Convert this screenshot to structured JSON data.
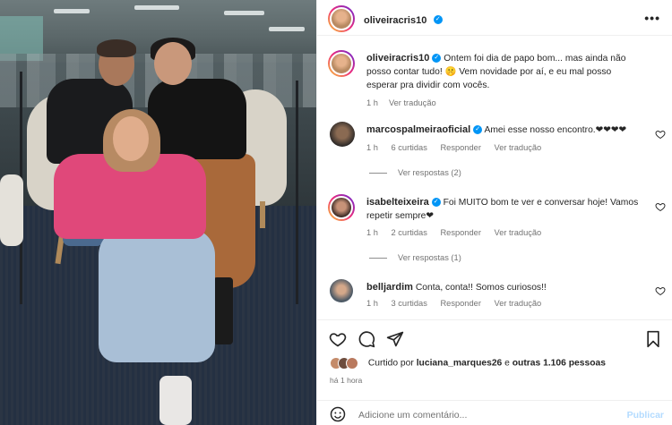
{
  "post": {
    "author": "oliveiracris10",
    "caption": "Ontem foi dia de papo bom... mas ainda não posso contar tudo! 🤫 Vem novidade por aí, e eu mal posso esperar pra dividir com vocês.",
    "caption_time": "1 h",
    "caption_translate": "Ver tradução"
  },
  "comments": [
    {
      "user": "marcospalmeiraoficial",
      "verified": true,
      "text": "Amei esse nosso encontro.❤❤❤❤",
      "time": "1 h",
      "likes": "6 curtidas",
      "reply": "Responder",
      "translate": "Ver tradução",
      "replies": "Ver respostas (2)"
    },
    {
      "user": "isabelteixeira",
      "verified": true,
      "text": "Foi MUITO bom te ver e conversar hoje! Vamos repetir sempre❤",
      "time": "1 h",
      "likes": "2 curtidas",
      "reply": "Responder",
      "translate": "Ver tradução",
      "replies": "Ver respostas (1)"
    },
    {
      "user": "belljardim",
      "verified": false,
      "text": "Conta, conta!! Somos curiosos!!",
      "time": "1 h",
      "likes": "3 curtidas",
      "reply": "Responder",
      "translate": "Ver tradução"
    }
  ],
  "likes_summary": {
    "prefix": "Curtido por",
    "user": "luciana_marques26",
    "middle": "e",
    "others": "outras 1.106 pessoas"
  },
  "posted_ago": "há 1 hora",
  "add_comment": {
    "placeholder": "Adicione um comentário...",
    "publish": "Publicar"
  },
  "icons": {
    "more": "more-options-icon",
    "like": "heart-icon",
    "comment": "comment-bubble-icon",
    "share": "paper-plane-icon",
    "save": "bookmark-icon",
    "emoji": "smiley-icon"
  },
  "colors": {
    "verified": "#0095f6",
    "muted_text": "#737373",
    "publish_disabled": "#b3dbff"
  }
}
